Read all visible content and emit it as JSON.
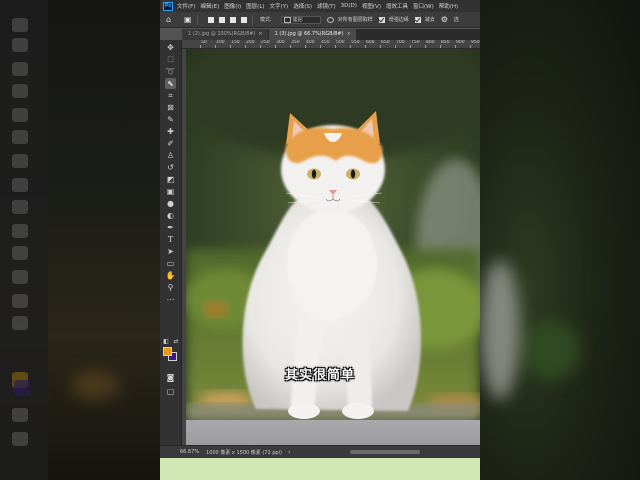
{
  "menubar": {
    "items": [
      "文件(F)",
      "编辑(E)",
      "图像(I)",
      "图层(L)",
      "文字(Y)",
      "选择(S)",
      "滤镜(T)",
      "3D(D)",
      "视图(V)",
      "增效工具",
      "窗口(W)",
      "帮助(H)"
    ]
  },
  "options": {
    "style_label": "模式:",
    "mode_value": "矩形",
    "sample_all_label": "对所有图层取样",
    "enhance_edge_label": "增强边缘",
    "subtract_label": "减去",
    "overflow_label": "选"
  },
  "tabs": [
    {
      "label": "1 (2).jpg @ 100%(RGB/8#)",
      "active": false
    },
    {
      "label": "1 (3).jpg @ 66.7%(RGB/8#)",
      "active": true
    }
  ],
  "ruler": {
    "labels": [
      "50",
      "100",
      "150",
      "200",
      "250",
      "300",
      "350",
      "400",
      "450",
      "500",
      "550",
      "600",
      "650",
      "700",
      "750",
      "800",
      "850",
      "900",
      "950"
    ]
  },
  "status": {
    "zoom": "66.67%",
    "doc_info": "1000 像素 x 1500 像素 (72 ppi)"
  },
  "subtitle": "其实很简单",
  "colors": {
    "foreground": "#e89a18",
    "background": "#3b1a8a",
    "ps_blue": "#31a8ff",
    "bottom_strip": "#cfe8b4"
  },
  "tools": [
    "move-icon",
    "marquee-icon",
    "lasso-icon",
    "object-select-icon",
    "crop-icon",
    "frame-icon",
    "eyedropper-icon",
    "healing-icon",
    "brush-icon",
    "stamp-icon",
    "history-brush-icon",
    "eraser-icon",
    "gradient-icon",
    "blur-icon",
    "dodge-icon",
    "pen-icon",
    "type-icon",
    "path-select-icon",
    "rectangle-icon",
    "hand-icon",
    "zoom-icon",
    "more-icon"
  ]
}
